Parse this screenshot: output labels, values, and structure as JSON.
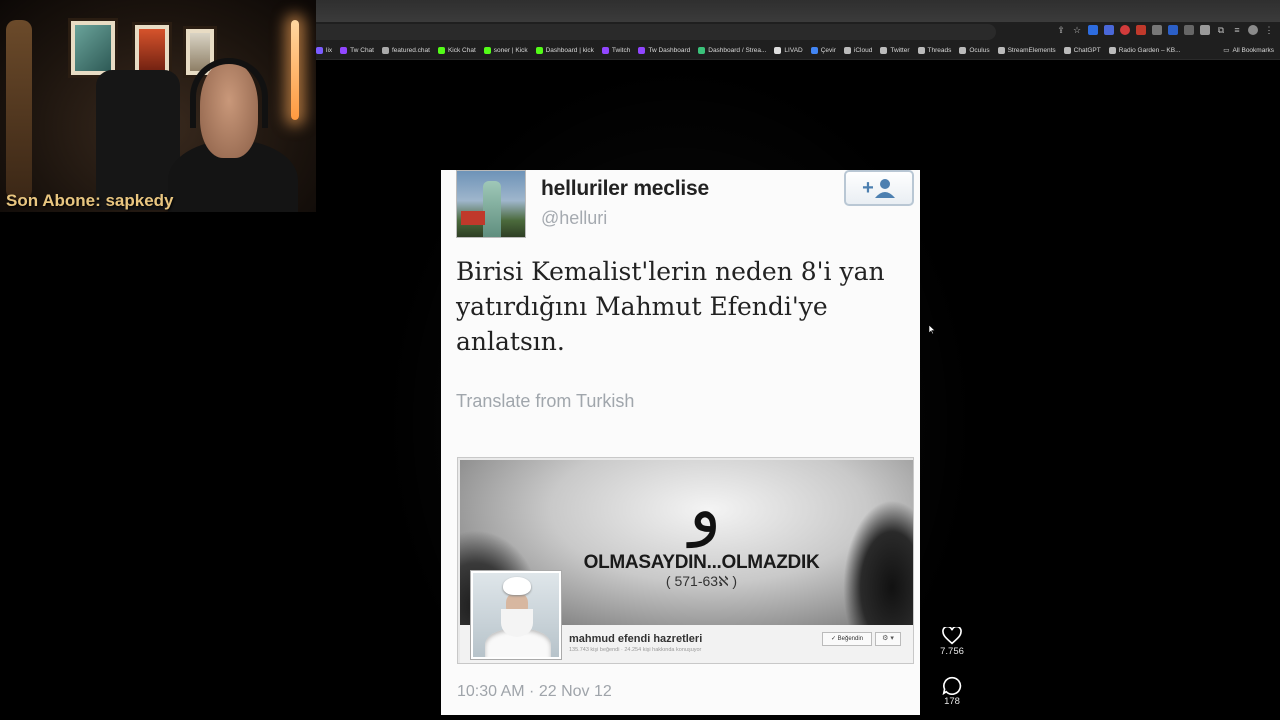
{
  "webcam": {
    "overlay_label": "Son Abone: sapkedy"
  },
  "bookmarks": [
    {
      "label": "lix",
      "color": "#7b5cff"
    },
    {
      "label": "Tw Chat",
      "color": "#9146ff"
    },
    {
      "label": "featured.chat",
      "color": "#aaaaaa"
    },
    {
      "label": "Kick Chat",
      "color": "#53fc18"
    },
    {
      "label": "soner | Kick",
      "color": "#53fc18"
    },
    {
      "label": "Dashboard | kick",
      "color": "#53fc18"
    },
    {
      "label": "Twitch",
      "color": "#9146ff"
    },
    {
      "label": "Tw Dashboard",
      "color": "#9146ff"
    },
    {
      "label": "Dashboard / Strea...",
      "color": "#3ac27a"
    },
    {
      "label": "LIVAD",
      "color": "#dddddd"
    },
    {
      "label": "Çevir",
      "color": "#4285f4"
    },
    {
      "label": "iCloud",
      "color": "#bbbbbb"
    },
    {
      "label": "Twitter",
      "color": "#bbbbbb"
    },
    {
      "label": "Threads",
      "color": "#bbbbbb"
    },
    {
      "label": "Oculus",
      "color": "#bbbbbb"
    },
    {
      "label": "StreamElements",
      "color": "#bbbbbb"
    },
    {
      "label": "ChatGPT",
      "color": "#bbbbbb"
    },
    {
      "label": "Radio Garden – KB...",
      "color": "#bbbbbb"
    }
  ],
  "all_bookmarks_label": "All Bookmarks",
  "tweet": {
    "display_name": "helluriler meclise",
    "handle": "@helluri",
    "text": "Birisi Kemalist'lerin neden 8'i yan yatırdığını Mahmut Efendi'ye anlatsın.",
    "translate_label": "Translate from Turkish",
    "timestamp": "10:30 AM · 22 Nov 12",
    "media": {
      "calligraphy": "و",
      "cover_title": "OLMASAYDIN...OLMAZDIK",
      "cover_subtitle": "( 571-63ℵ )",
      "page_name": "mahmud efendi hazretleri",
      "page_meta": "135.743 kişi beğendi · 24.254 kişi hakkında konuşuyor",
      "like_button": "✓ Beğendin",
      "gear_button": "⚙ ▾"
    }
  },
  "actions": {
    "likes": "7.756",
    "comments": "178"
  }
}
